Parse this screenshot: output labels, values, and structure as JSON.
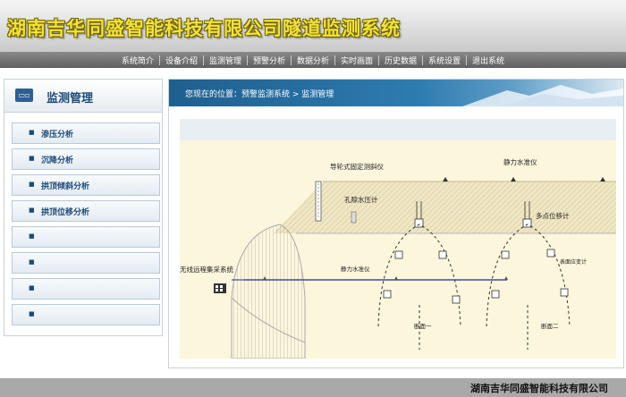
{
  "site_title": "湖南吉华同盛智能科技有限公司隧道监测系统",
  "nav": [
    "系统简介",
    "设备介绍",
    "监测管理",
    "预警分析",
    "数据分析",
    "实时画面",
    "历史数据",
    "系统设置",
    "退出系统"
  ],
  "sidebar": {
    "title": "监测管理",
    "items": [
      {
        "label": "渗压分析"
      },
      {
        "label": "沉降分析"
      },
      {
        "label": "拱顶倾斜分析"
      },
      {
        "label": "拱顶位移分析"
      },
      {
        "label": ""
      },
      {
        "label": ""
      },
      {
        "label": ""
      },
      {
        "label": ""
      }
    ]
  },
  "breadcrumb": "您现在的位置：预警监测系统 > 监测管理",
  "diagram": {
    "labels": {
      "inclinometer": "导轮式固定测斜仪",
      "static_level": "静力水准仪",
      "piezometer": "孔隙水压计",
      "multipoint": "多点位移计",
      "wireless": "无线远程集采系统",
      "static_level_2": "静力水准仪",
      "surface_strain": "表面应变计",
      "section_1": "断面一",
      "section_2": "断面二"
    }
  },
  "footer": "湖南吉华同盛智能科技有限公司",
  "colors": {
    "nav_bg": "#6e6e6e",
    "accent_blue": "#1f5f8f",
    "title_yellow": "#f3e23a",
    "diagram_bg": "#fbf6dc"
  }
}
